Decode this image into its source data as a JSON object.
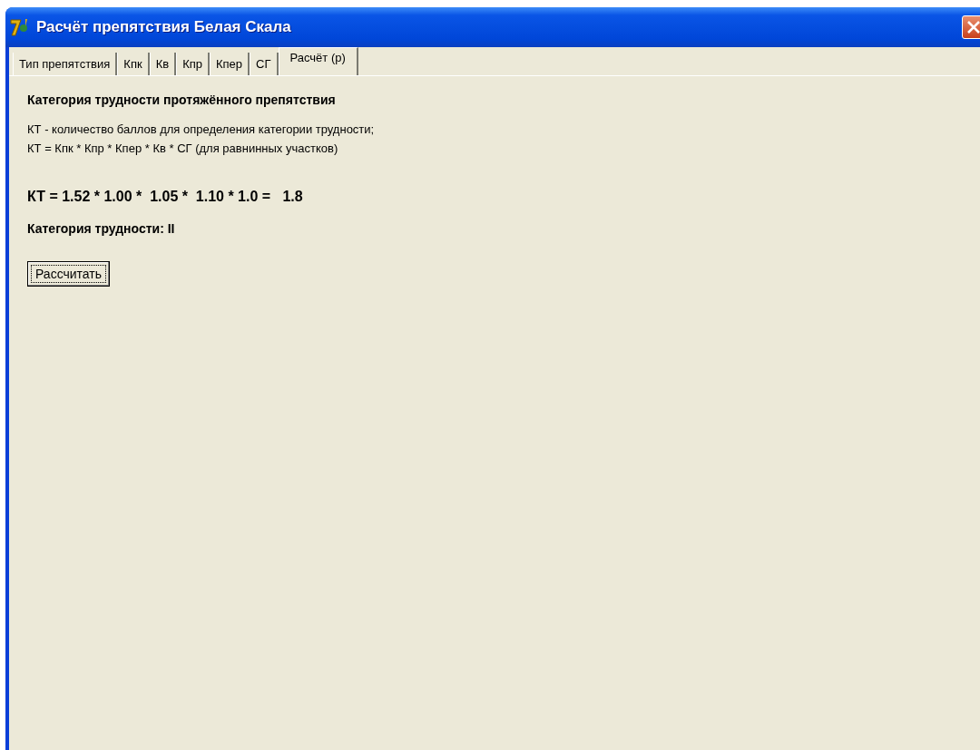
{
  "window": {
    "title": "Расчёт препятствия Белая Скала"
  },
  "tabs": [
    {
      "label": "Тип препятствия",
      "selected": false
    },
    {
      "label": "Кпк",
      "selected": false
    },
    {
      "label": "Кв",
      "selected": false
    },
    {
      "label": "Кпр",
      "selected": false
    },
    {
      "label": "Кпер",
      "selected": false
    },
    {
      "label": "СГ",
      "selected": false
    },
    {
      "label": "Расчёт (р)",
      "selected": true
    }
  ],
  "heading": "Категория трудности протяжённого препятствия",
  "description": [
    "КТ - количество баллов для определения категории трудности;",
    "КТ = Кпк * Кпр * Кпер * Кв * СГ (для равнинных участков)"
  ],
  "formula": "КТ = 1.52 * 1.00 *  1.05 *  1.10 * 1.0 =   1.8",
  "category": "Категория трудности: II",
  "button": "Рассчитать"
}
